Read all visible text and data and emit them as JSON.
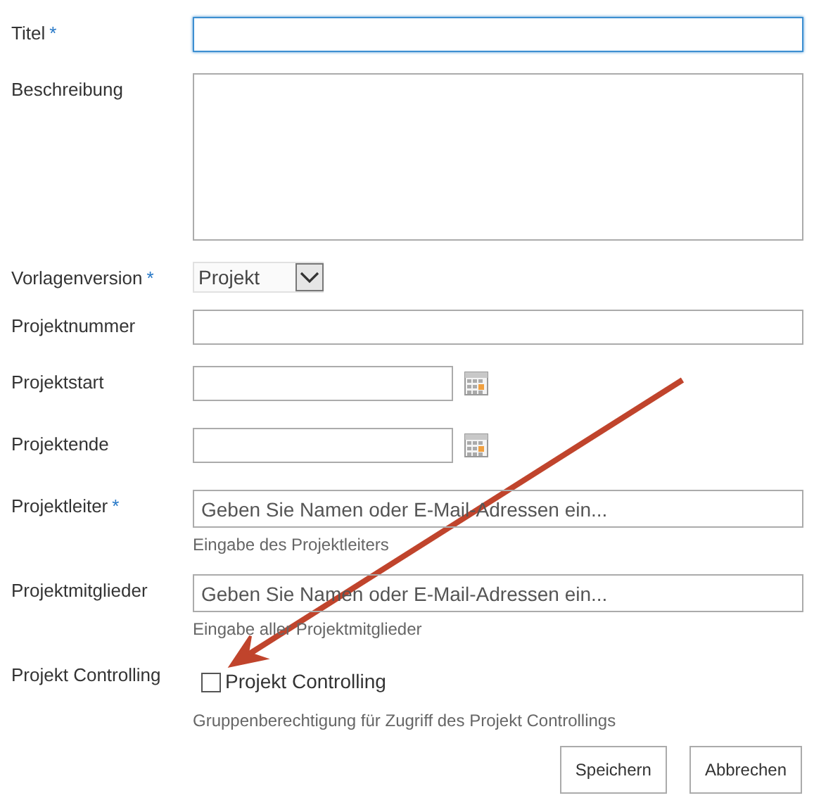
{
  "fields": [
    {
      "kind": "text",
      "label": "Titel",
      "required": true,
      "focused": true
    },
    {
      "kind": "textarea",
      "label": "Beschreibung",
      "required": false,
      "focused": false
    },
    {
      "kind": "select",
      "label": "Vorlagenversion",
      "required": true,
      "value": "Projekt"
    },
    {
      "kind": "text",
      "label": "Projektnummer",
      "required": false,
      "focused": false
    },
    {
      "kind": "date",
      "label": "Projektstart",
      "required": false
    },
    {
      "kind": "date",
      "label": "Projektende",
      "required": false
    },
    {
      "kind": "people",
      "label": "Projektleiter",
      "required": true,
      "placeholder": "Geben Sie Namen oder E-Mail-Adressen ein...",
      "hint": "Eingabe des Projektleiters"
    },
    {
      "kind": "people",
      "label": "Projektmitglieder",
      "required": false,
      "placeholder": "Geben Sie Namen oder E-Mail-Adressen ein...",
      "hint": "Eingabe aller Projektmitglieder"
    },
    {
      "kind": "checkbox",
      "label": "Projekt Controlling",
      "required": false,
      "option": "Projekt Controlling",
      "checked": false,
      "hint": "Gruppenberechtigung für Zugriff des Projekt Controllings"
    }
  ],
  "required_mark": "*",
  "buttons": [
    "Speichern",
    "Abbrechen"
  ]
}
